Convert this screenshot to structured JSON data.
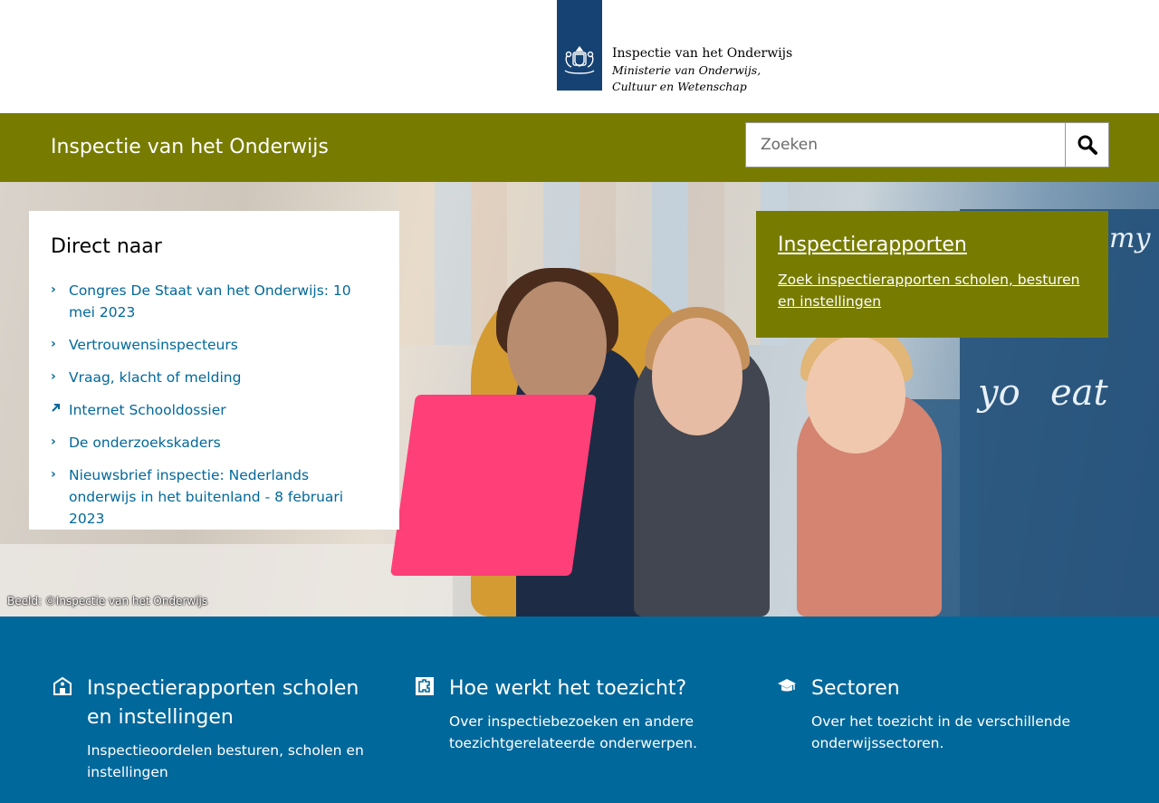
{
  "logo": {
    "title": "Inspectie van het Onderwijs",
    "subtitle": "Ministerie van Onderwijs, Cultuur en Wetenschap",
    "icon": "coat-of-arms-icon",
    "ribbon_color": "#154273"
  },
  "header": {
    "site_name": "Inspectie van het Onderwijs",
    "band_color": "#777c00",
    "search": {
      "placeholder": "Zoeken",
      "value": "",
      "button_icon": "search-icon"
    }
  },
  "hero": {
    "credit": "Beeld: ©Inspectie van het Onderwijs"
  },
  "direct_naar": {
    "title": "Direct naar",
    "items": [
      {
        "label": "Congres De Staat van het Onderwijs: 10 mei 2023",
        "icon": "chevron-right-icon"
      },
      {
        "label": "Vertrouwensinspecteurs",
        "icon": "chevron-right-icon"
      },
      {
        "label": "Vraag, klacht of melding",
        "icon": "chevron-right-icon"
      },
      {
        "label": "Internet Schooldossier",
        "icon": "external-link-icon"
      },
      {
        "label": "De onderzoekskaders",
        "icon": "chevron-right-icon"
      },
      {
        "label": "Nieuwsbrief inspectie: Nederlands onderwijs in het buitenland - 8 februari 2023",
        "icon": "chevron-right-icon"
      }
    ]
  },
  "inspectierapporten_card": {
    "title": "Inspectierapporten",
    "link": "Zoek inspectierapporten scholen, besturen en instellingen"
  },
  "topics": [
    {
      "icon": "school-building-icon",
      "title": "Inspectierapporten scholen en instellingen",
      "text": "Inspectieoordelen besturen, scholen en instellingen"
    },
    {
      "icon": "puzzle-icon",
      "title": "Hoe werkt het toezicht?",
      "text": "Over inspectiebezoeken en andere toezichtgerelateerde onderwerpen."
    },
    {
      "icon": "graduation-cap-icon",
      "title": "Sectoren",
      "text": "Over het toezicht in de verschillende onderwijssectoren."
    }
  ],
  "colors": {
    "blue": "#01689b",
    "olive": "#777c00",
    "link": "#01689b"
  }
}
